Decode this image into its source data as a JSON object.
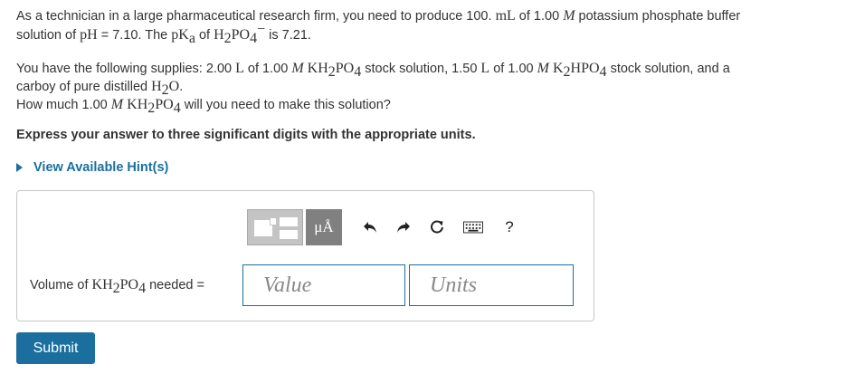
{
  "question": {
    "line1": {
      "p1": "As a technician in a large pharmaceutical research firm, you need to produce 100. ",
      "unit_ml": "mL",
      "p2": " of 1.00 ",
      "M": "M",
      "p3": " potassium phosphate buffer"
    },
    "line2": {
      "p1": "solution of ",
      "pH": "pH",
      "p2": " = 7.10. The ",
      "pKa_p": "pK",
      "pKa_a": "a",
      "p3": " of ",
      "H": "H",
      "sub2": "2",
      "PO": "PO",
      "sub4": "4",
      "charge": "−",
      "p4": " is 7.21."
    },
    "line3": {
      "p1": "You have the following supplies: 2.00 ",
      "L1": "L",
      "p2": " of 1.00 ",
      "M1": "M",
      "f1a": "KH",
      "f1b": "2",
      "f1c": "PO",
      "f1d": "4",
      "p3": " stock solution, 1.50 ",
      "L2": "L",
      "p4": " of 1.00 ",
      "M2": "M",
      "f2a": "K",
      "f2b": "2",
      "f2c": "HPO",
      "f2d": "4",
      "p5": " stock solution, and a"
    },
    "line4": {
      "p1": "carboy of pure distilled ",
      "h": "H",
      "sub": "2",
      "o": "O",
      "p2": "."
    },
    "line5": {
      "p1": "How much 1.00 ",
      "M": "M",
      "fa": "KH",
      "fb": "2",
      "fc": "PO",
      "fd": "4",
      "p2": " will you need to make this solution?"
    }
  },
  "instruction": "Express your answer to three significant digits with the appropriate units.",
  "hint_label": "View Available Hint(s)",
  "toolbar": {
    "units_label": "μÅ",
    "help_label": "?"
  },
  "answer": {
    "label_prefix": "Volume of ",
    "fa": "KH",
    "fb": "2",
    "fc": "PO",
    "fd": "4",
    "label_suffix": " needed =",
    "value_placeholder": "Value",
    "units_placeholder": "Units"
  },
  "submit_label": "Submit",
  "colors": {
    "link": "#1a6f9e",
    "button": "#1a6f9e",
    "text": "#333333"
  }
}
